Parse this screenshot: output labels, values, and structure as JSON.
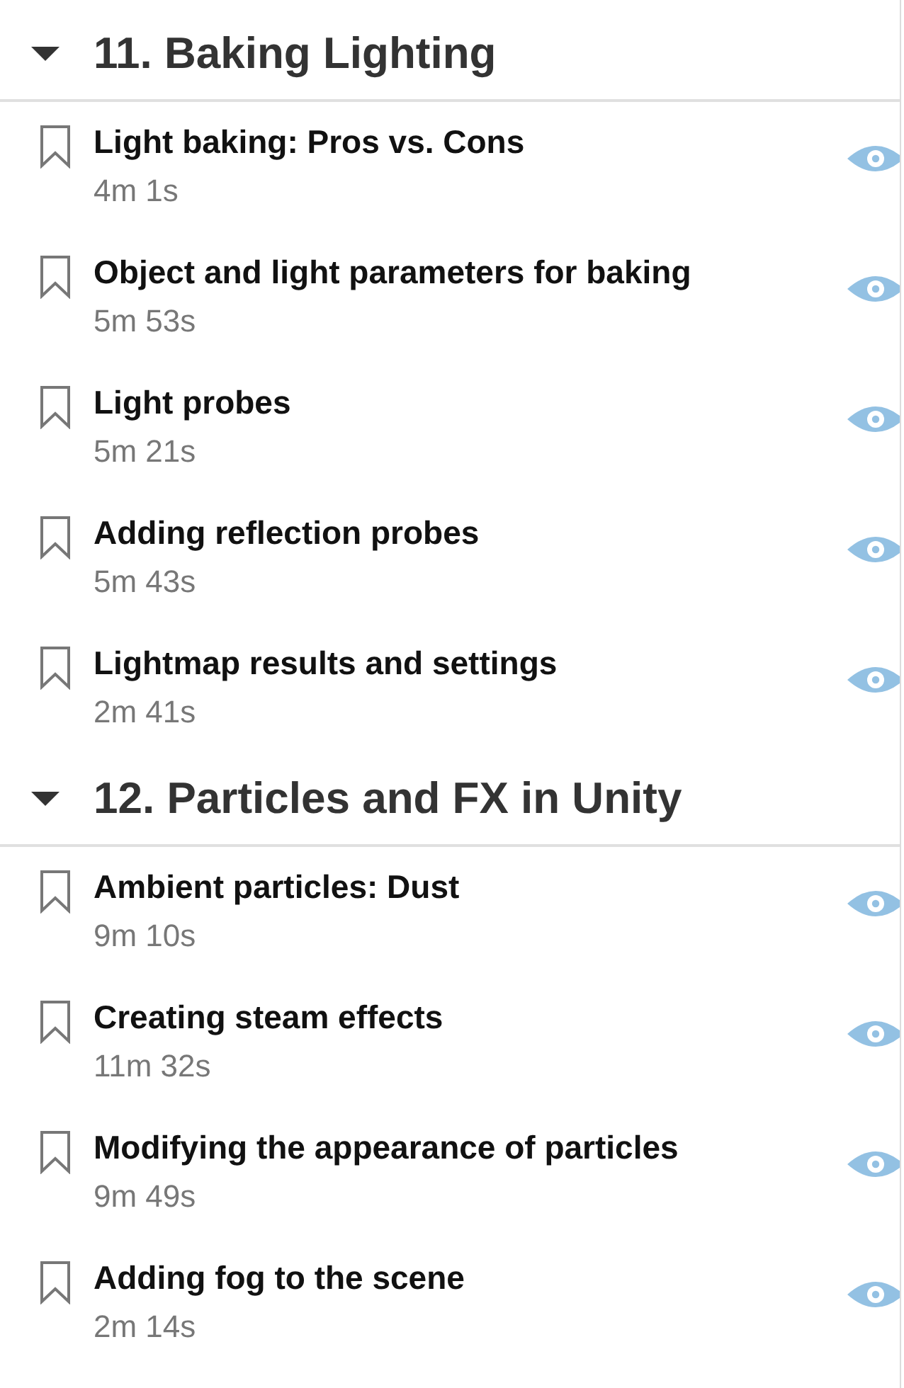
{
  "sections": [
    {
      "title": "11. Baking Lighting",
      "expanded": true,
      "lessons": [
        {
          "title": "Light baking: Pros vs. Cons",
          "duration": "4m 1s",
          "bookmarked": false
        },
        {
          "title": "Object and light parameters for baking",
          "duration": "5m 53s",
          "bookmarked": false
        },
        {
          "title": "Light probes",
          "duration": "5m 21s",
          "bookmarked": false
        },
        {
          "title": "Adding reflection probes",
          "duration": "5m 43s",
          "bookmarked": false
        },
        {
          "title": "Lightmap results and settings",
          "duration": "2m 41s",
          "bookmarked": false
        }
      ]
    },
    {
      "title": "12. Particles and FX in Unity",
      "expanded": true,
      "lessons": [
        {
          "title": "Ambient particles: Dust",
          "duration": "9m 10s",
          "bookmarked": false
        },
        {
          "title": "Creating steam effects",
          "duration": "11m 32s",
          "bookmarked": false
        },
        {
          "title": "Modifying the appearance of particles",
          "duration": "9m 49s",
          "bookmarked": false
        },
        {
          "title": "Adding fog to the scene",
          "duration": "2m 14s",
          "bookmarked": false
        }
      ]
    }
  ]
}
